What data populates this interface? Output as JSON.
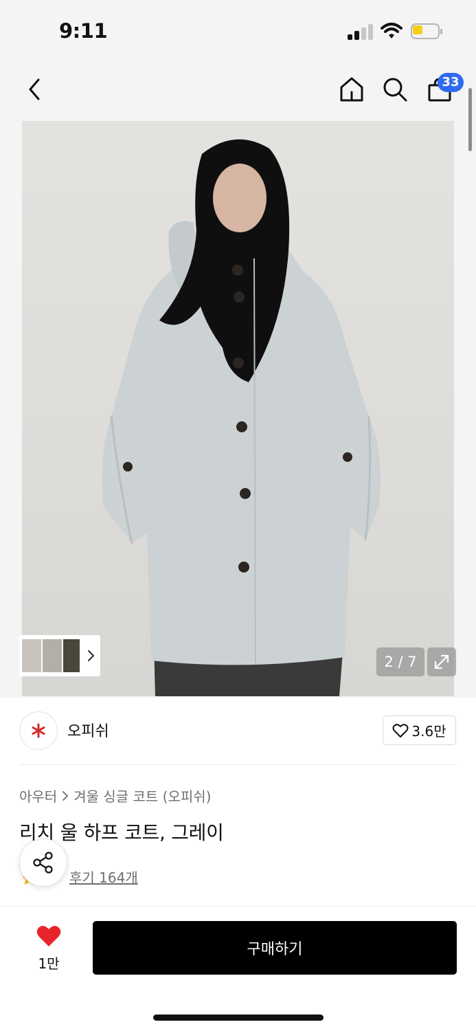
{
  "status_bar": {
    "time": "9:11",
    "icons": [
      "cellular-signal-icon",
      "wifi-icon",
      "battery-icon"
    ]
  },
  "nav": {
    "icons": [
      "chevron-left-icon",
      "home-icon",
      "search-icon",
      "shopping-bag-icon"
    ],
    "cart_badge": "33"
  },
  "gallery": {
    "page_counter": "2 / 7",
    "current_page": 2,
    "total_pages": 7,
    "icons": [
      "chevron-right-icon",
      "expand-icon"
    ]
  },
  "brand": {
    "name": "오피쉬",
    "like_count": "3.6만",
    "logo_color": "#d62b2b",
    "icons": [
      "brand-logo-icon",
      "heart-outline-icon"
    ]
  },
  "breadcrumb": {
    "category": "아우터",
    "subcategory": "겨울 싱글 코트 (오피쉬)"
  },
  "product": {
    "title": "리치 울 하프 코트, 그레이",
    "reviews": "후기 164개"
  },
  "share": {
    "icon": "share-icon"
  },
  "bottom_bar": {
    "wish_count": "1만",
    "buy_label": "구매하기",
    "heart_color": "#e8242b",
    "buy_bg": "#000000"
  },
  "colors": {
    "accent_badge": "#2f6af0",
    "battery_fill": "#f7cd1a",
    "star": "#f5b400"
  }
}
